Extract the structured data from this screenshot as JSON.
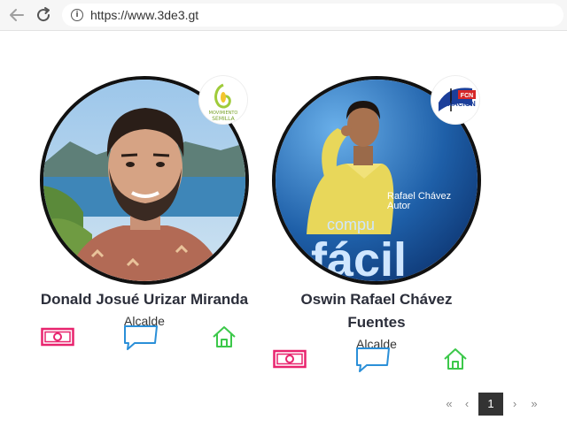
{
  "browser": {
    "url": "https://www.3de3.gt"
  },
  "candidates": [
    {
      "name": "Donald Josué Urizar Miranda",
      "role": "Alcalde",
      "party_logo_text": [
        "MOVIMIENTO",
        "SEMILLA"
      ]
    },
    {
      "name": "Oswin Rafael Chávez Fuentes",
      "role": "Alcalde",
      "party_logo_text": [
        "FCN",
        "NACION"
      ],
      "photo_text": [
        "Rafael Chávez",
        "Autor",
        "compu",
        "fácil"
      ]
    }
  ],
  "pagination": {
    "first": "«",
    "prev": "‹",
    "current": "1",
    "next": "›",
    "last": "»"
  },
  "colors": {
    "money_icon": "#e8246e",
    "chat_icon": "#2a8fd8",
    "home_icon": "#3cc84a",
    "name_text": "#2b2e3a"
  }
}
